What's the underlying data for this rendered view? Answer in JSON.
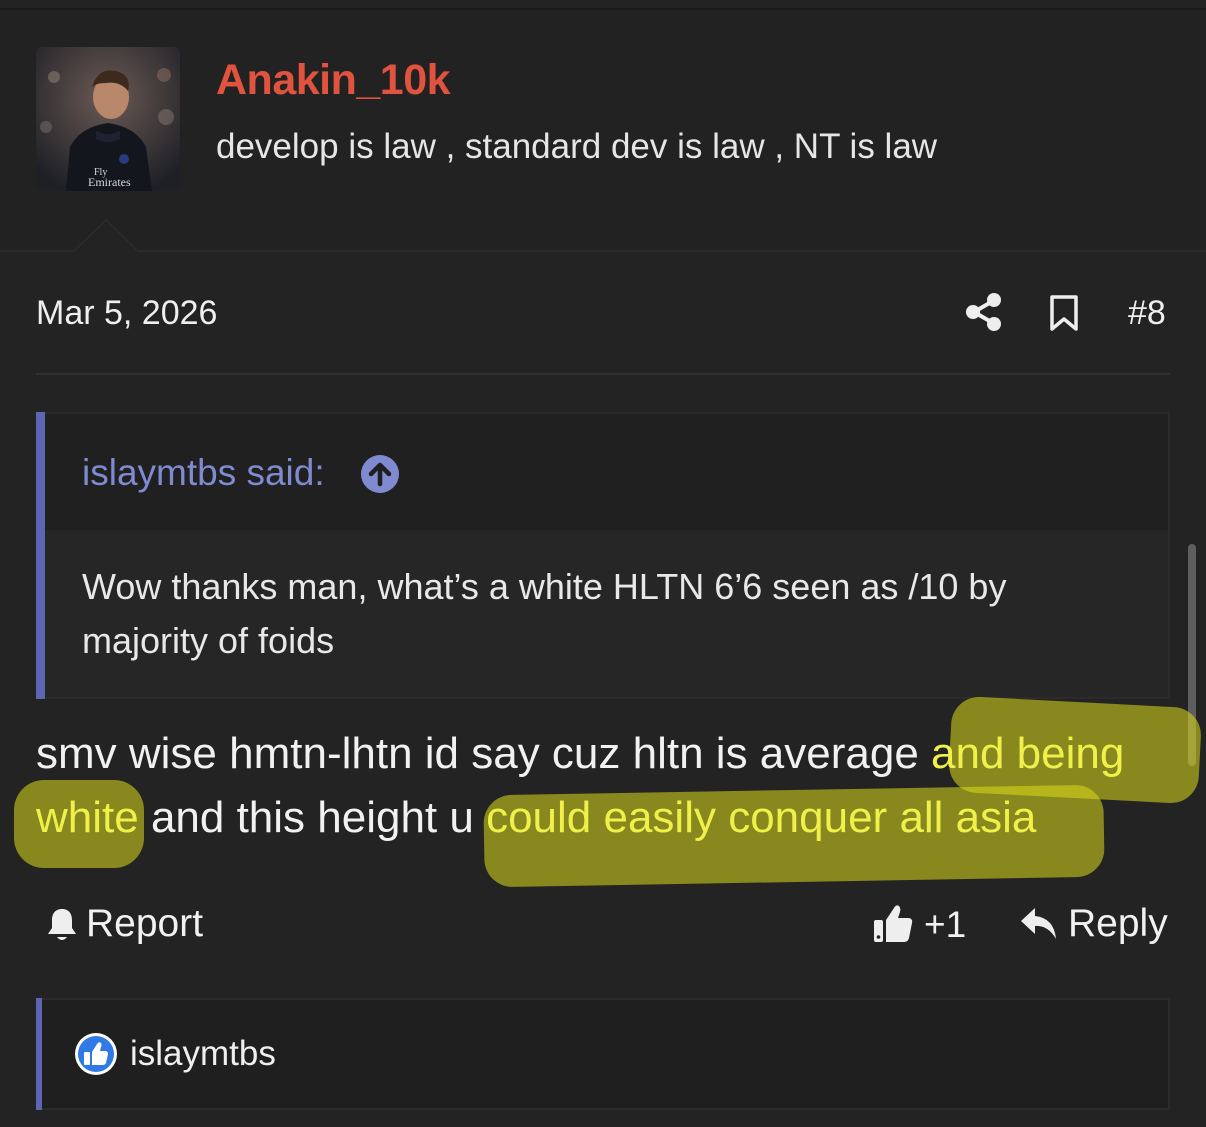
{
  "user": {
    "name": "Anakin_10k",
    "signature": "develop is law , standard dev is law , NT is law",
    "avatar_jersey_text": "Fly\nEmirates"
  },
  "post": {
    "date": "Mar 5, 2026",
    "number": "#8",
    "icons": [
      "share-icon",
      "bookmark-icon"
    ]
  },
  "quote": {
    "author": "islaymtbs said:",
    "text": "Wow thanks man, what’s a white HLTN 6’6 seen as /10 by majority of foids",
    "icon": "arrow-up-circle-icon"
  },
  "message": {
    "part1": "smv wise hmtn-lhtn id say cuz hltn is average ",
    "highlight1": "and being white",
    "part2": " and this height u ",
    "highlight2": "could easily conquer all asia"
  },
  "actions": {
    "report": "Report",
    "like_count": "+1",
    "reply": "Reply"
  },
  "reactions": {
    "user": "islaymtbs",
    "icon": "like-badge-icon"
  },
  "colors": {
    "background": "#232323",
    "username": "#e0533e",
    "quote_accent": "#5c66b4",
    "quote_author": "#7f8ad0",
    "highlight": "#dcdc1c"
  }
}
